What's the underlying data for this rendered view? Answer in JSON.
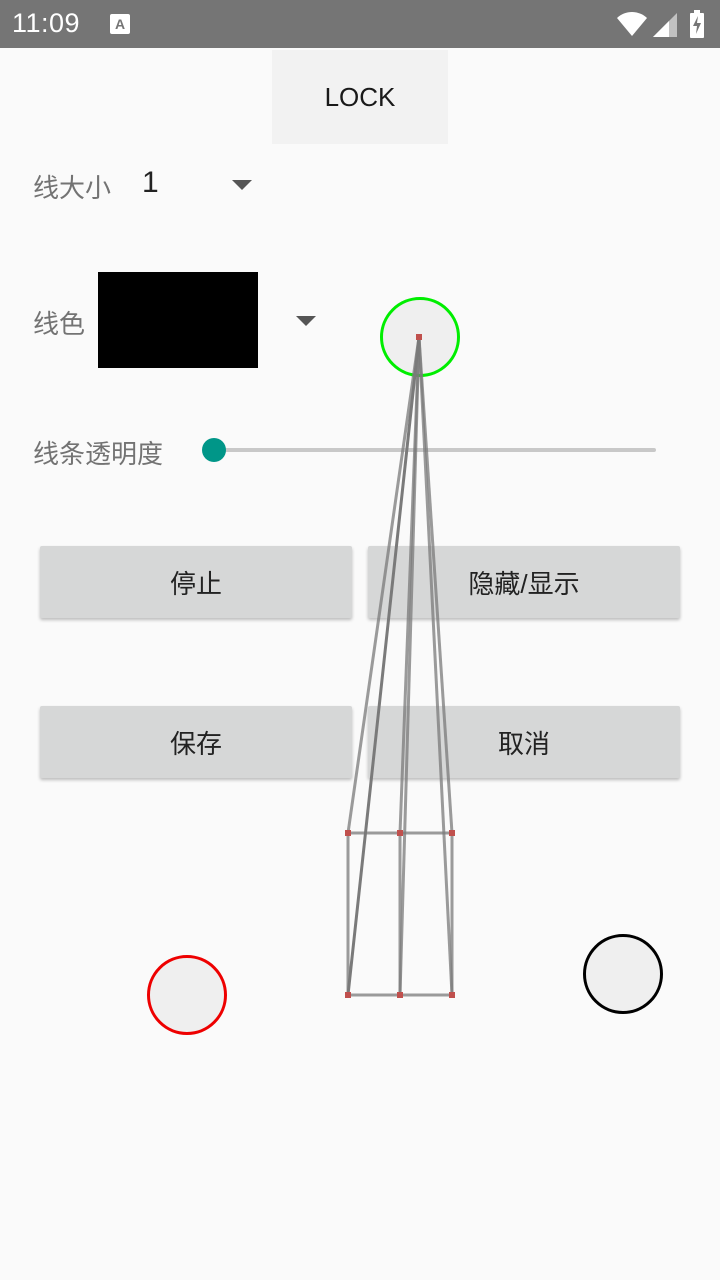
{
  "status_bar": {
    "time": "11:09",
    "icons": [
      "app-notification-icon",
      "wifi-icon",
      "cell-signal-icon",
      "battery-charging-icon"
    ]
  },
  "lock_button": {
    "label": "LOCK"
  },
  "line_size": {
    "label": "线大小",
    "value": "1"
  },
  "line_color": {
    "label": "线色",
    "swatch_color": "#000000"
  },
  "line_opacity": {
    "label": "线条透明度",
    "value": 0,
    "thumb_color": "#009688"
  },
  "buttons": {
    "stop": "停止",
    "hide_show": "隐藏/显示",
    "save": "保存",
    "cancel": "取消"
  },
  "handles": {
    "top_color": "#00ee00",
    "left_color": "#ee0000",
    "right_color": "#000000"
  },
  "wireframe": {
    "line_color": "#7a7a7a",
    "vertex_color": "#c0504d"
  }
}
